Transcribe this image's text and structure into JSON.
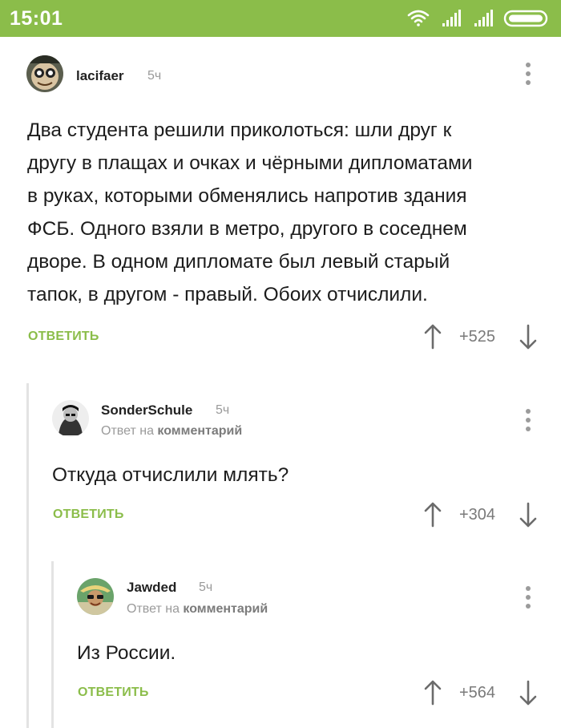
{
  "status_bar": {
    "time": "15:01",
    "icons": [
      "wifi-icon",
      "signal-icon",
      "signal-icon",
      "battery-icon"
    ]
  },
  "comments": [
    {
      "username": "lacifaer",
      "time": "5ч",
      "text_lines": [
        "Два студента решили приколоться: шли друг к",
        "другу в плащах и очках и чёрными дипломатами",
        "в руках, которыми обменялись напротив здания",
        "ФСБ. Одного взяли в метро, другого в соседнем",
        "дворе. В одном дипломате был левый старый",
        "тапок, в другом - правый. Обоих отчислили."
      ],
      "reply_label": "ОТВЕТИТЬ",
      "rating": "+525"
    },
    {
      "username": "SonderSchule",
      "time": "5ч",
      "reply_prefix": "Ответ на",
      "reply_target": "комментарий",
      "text_lines": [
        "Откуда отчислили млять?"
      ],
      "reply_label": "ОТВЕТИТЬ",
      "rating": "+304"
    },
    {
      "username": "Jawded",
      "time": "5ч",
      "reply_prefix": "Ответ на",
      "reply_target": "комментарий",
      "text_lines": [
        "Из России."
      ],
      "reply_label": "ОТВЕТИТЬ",
      "rating": "+564"
    }
  ],
  "colors": {
    "accent": "#8bbd4a",
    "muted": "#9a9a9a",
    "thread_line": "#e3e3e3"
  }
}
